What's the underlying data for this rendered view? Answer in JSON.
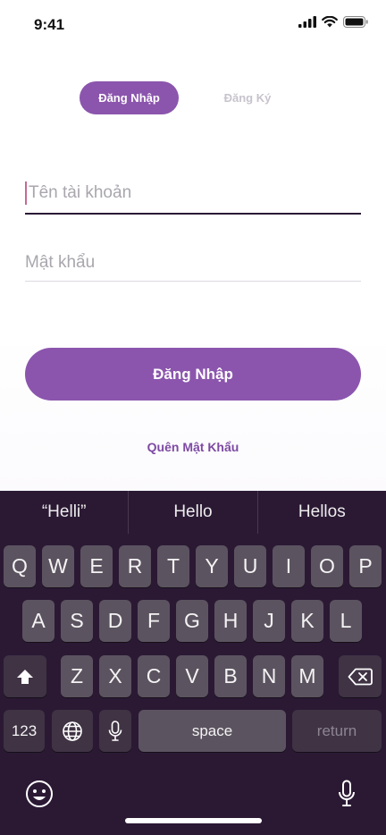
{
  "status_bar": {
    "time": "9:41"
  },
  "tabs": {
    "active": "Đăng Nhập",
    "inactive": "Đăng Ký"
  },
  "form": {
    "username_placeholder": "Tên tài khoản",
    "password_placeholder": "Mật khẩu",
    "login_button": "Đăng Nhập",
    "forgot_password": "Quên Mật Khẩu"
  },
  "keyboard": {
    "suggestions": [
      "“Helli”",
      "Hello",
      "Hellos"
    ],
    "row1": [
      "Q",
      "W",
      "E",
      "R",
      "T",
      "Y",
      "U",
      "I",
      "O",
      "P"
    ],
    "row2": [
      "A",
      "S",
      "D",
      "F",
      "G",
      "H",
      "J",
      "K",
      "L"
    ],
    "row3": [
      "Z",
      "X",
      "C",
      "V",
      "B",
      "N",
      "M"
    ],
    "numbers_key": "123",
    "space_key": "space",
    "return_key": "return"
  },
  "colors": {
    "accent": "#8b55ad",
    "keyboard_bg": "#2b1934",
    "key_bg": "#5c5360"
  }
}
